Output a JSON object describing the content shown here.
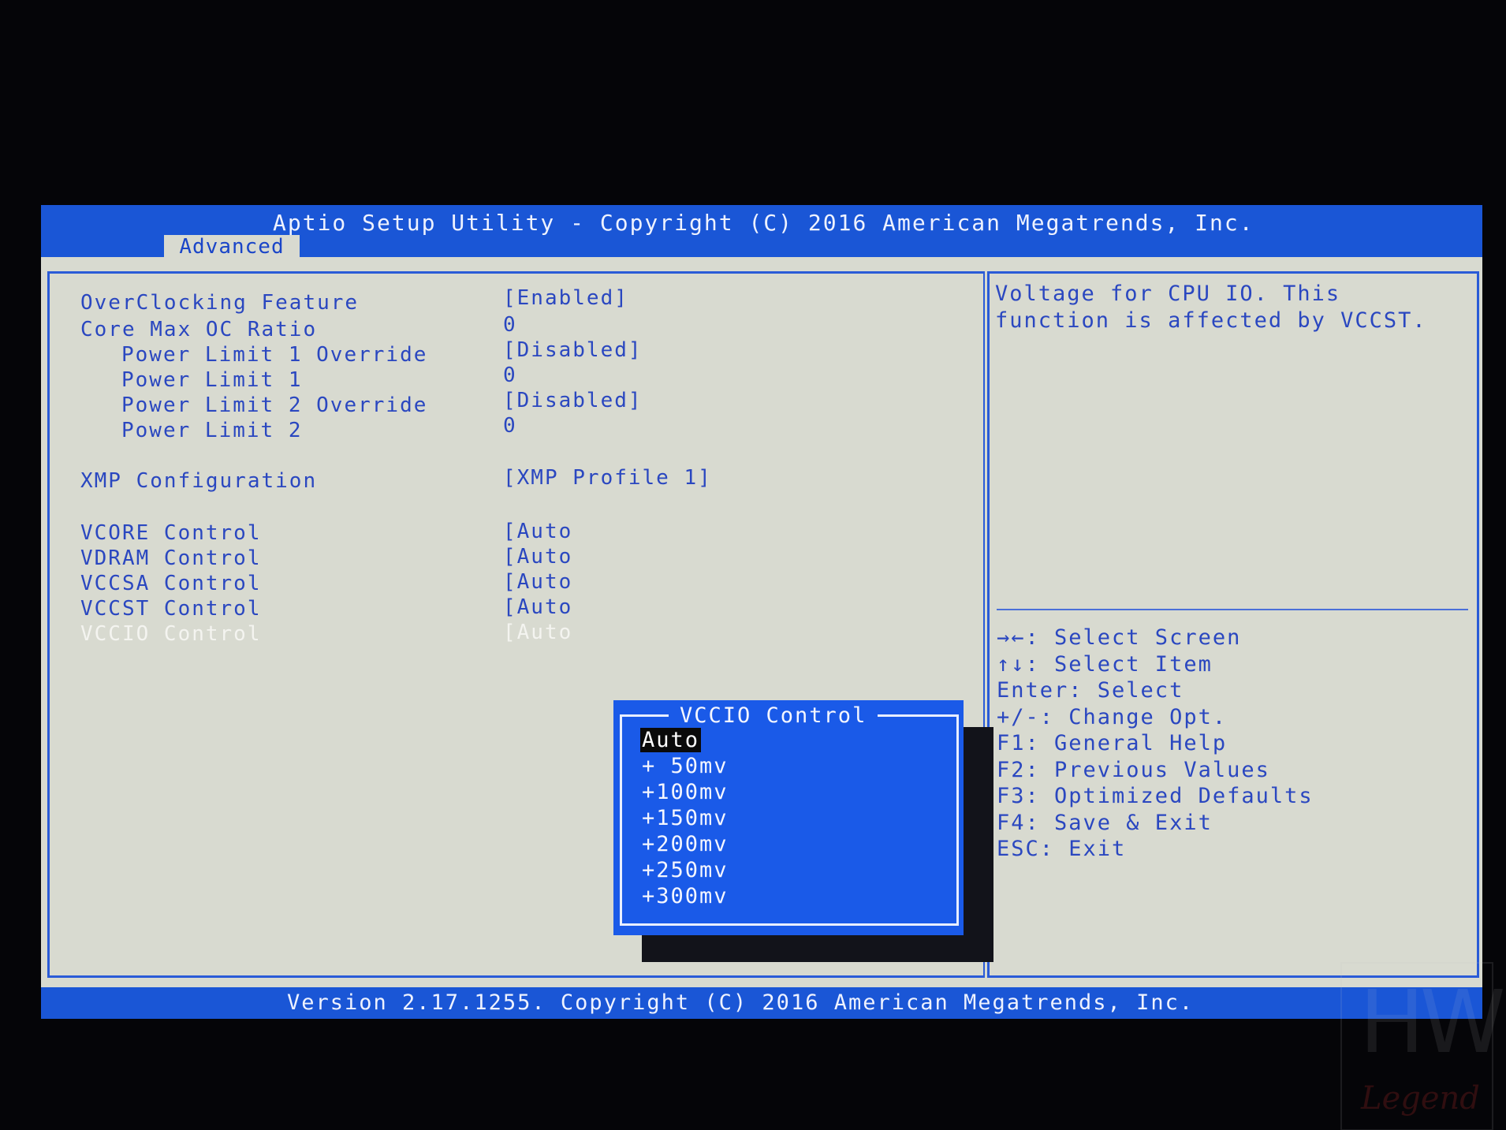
{
  "title": "Aptio Setup Utility - Copyright (C) 2016 American Megatrends, Inc.",
  "tab": "Advanced",
  "settings": [
    {
      "label": "OverClocking Feature",
      "value": "[Enabled]",
      "indent": false
    },
    {
      "label": "Core Max OC Ratio",
      "value": "0",
      "indent": false
    },
    {
      "label": "Power Limit 1 Override",
      "value": "[Disabled]",
      "indent": true
    },
    {
      "label": "Power Limit 1",
      "value": "0",
      "indent": true
    },
    {
      "label": "Power Limit 2 Override",
      "value": "[Disabled]",
      "indent": true
    },
    {
      "label": "Power Limit 2",
      "value": "0",
      "indent": true
    },
    {
      "label": "XMP Configuration",
      "value": "[XMP Profile 1]",
      "indent": false
    },
    {
      "label": "VCORE Control",
      "value": "[Auto",
      "indent": false
    },
    {
      "label": "VDRAM Control",
      "value": "[Auto",
      "indent": false
    },
    {
      "label": "VCCSA Control",
      "value": "[Auto",
      "indent": false
    },
    {
      "label": "VCCST Control",
      "value": "[Auto",
      "indent": false
    },
    {
      "label": "VCCIO Control",
      "value": "[Auto",
      "indent": false
    }
  ],
  "help": {
    "line1": "Voltage for CPU IO. This",
    "line2": "function is affected by VCCST."
  },
  "keys": [
    "→←: Select Screen",
    "↑↓: Select Item",
    "Enter: Select",
    "+/-: Change Opt.",
    "F1: General Help",
    "F2: Previous Values",
    "F3: Optimized Defaults",
    "F4: Save & Exit",
    "ESC: Exit"
  ],
  "popup": {
    "title": "VCCIO Control",
    "options": [
      "Auto",
      "+ 50mv",
      "+100mv",
      "+150mv",
      "+200mv",
      "+250mv",
      "+300mv"
    ],
    "selected": "Auto"
  },
  "footer": "Version 2.17.1255. Copyright (C) 2016 American Megatrends, Inc.",
  "watermark": {
    "mark": "HW",
    "word": "Legend"
  }
}
